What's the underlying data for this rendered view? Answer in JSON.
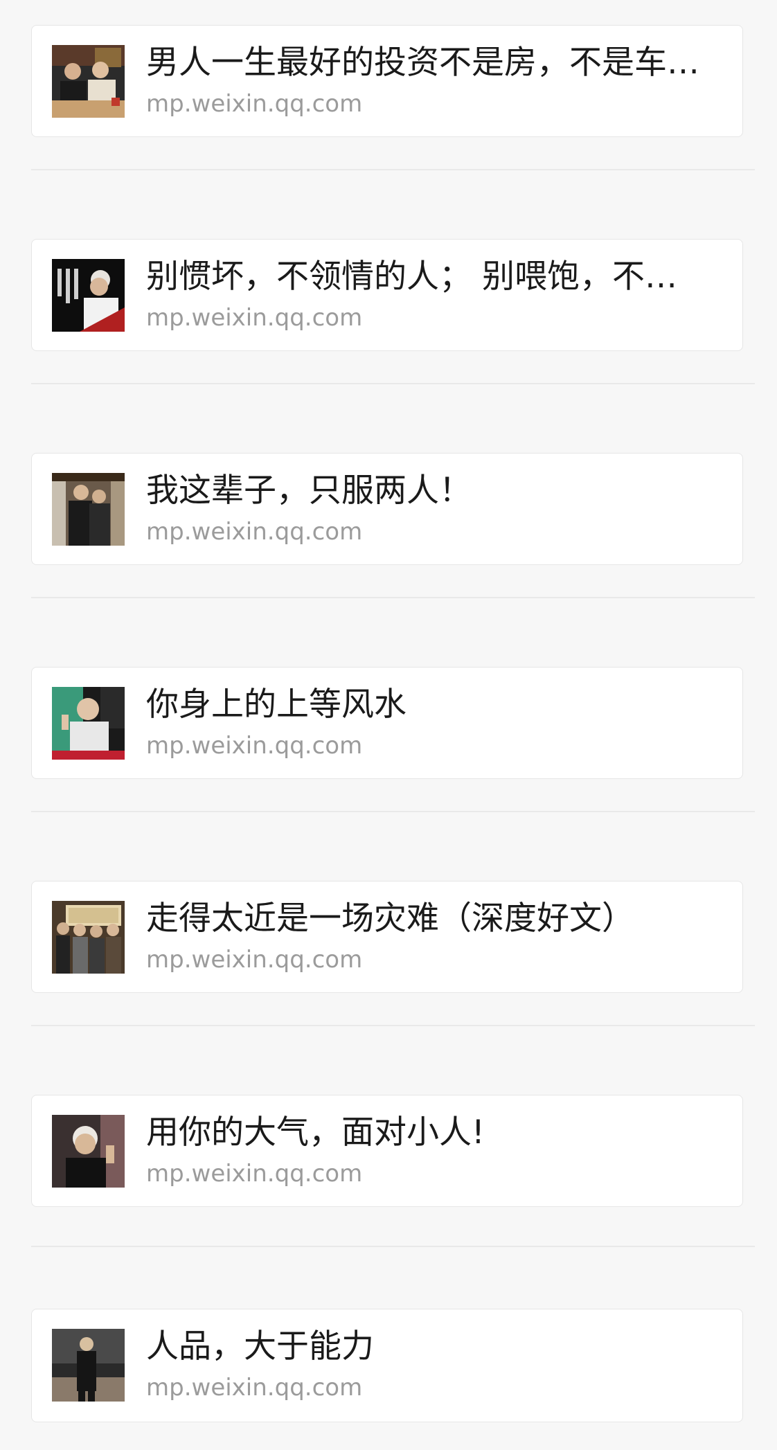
{
  "articles": [
    {
      "title": "男人一生最好的投资不是房，不是车…",
      "source": "mp.weixin.qq.com",
      "thumbnail": "two-men-at-dinner-table"
    },
    {
      "title": "别惯坏，不领情的人； 别喂饱，不…",
      "source": "mp.weixin.qq.com",
      "thumbnail": "elderly-man-with-calligraphy"
    },
    {
      "title": "我这辈子，只服两人！",
      "source": "mp.weixin.qq.com",
      "thumbnail": "two-men-standing-indoors"
    },
    {
      "title": "你身上的上等风水",
      "source": "mp.weixin.qq.com",
      "thumbnail": "elderly-man-speaking"
    },
    {
      "title": "走得太近是一场灾难（深度好文）",
      "source": "mp.weixin.qq.com",
      "thumbnail": "group-photo-with-plaque"
    },
    {
      "title": "用你的大气，面对小人!",
      "source": "mp.weixin.qq.com",
      "thumbnail": "elderly-man-portrait"
    },
    {
      "title": "人品，大于能力",
      "source": "mp.weixin.qq.com",
      "thumbnail": "man-standing-full-length"
    }
  ]
}
